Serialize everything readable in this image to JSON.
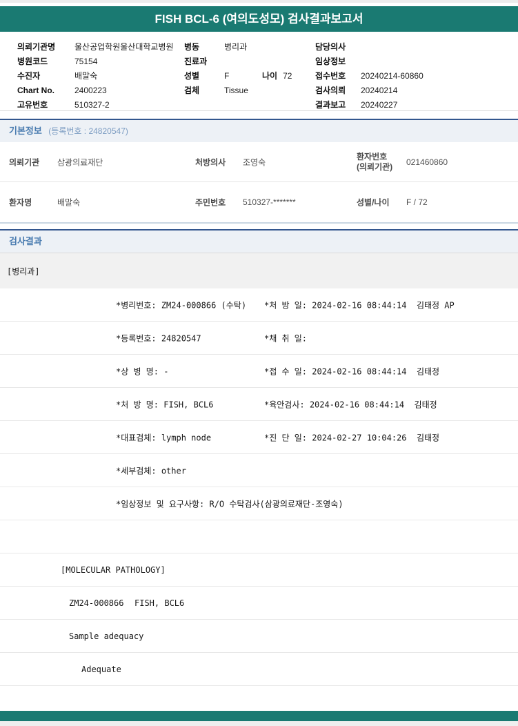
{
  "title": "FISH BCL-6 (여의도성모) 검사결과보고서",
  "header": {
    "left": [
      {
        "label": "의뢰기관명",
        "value": "울산공업학원울산대학교병원"
      },
      {
        "label": "병원코드",
        "value": "75154"
      },
      {
        "label": "수진자",
        "value": "배말숙"
      },
      {
        "label": "Chart No.",
        "value": "2400223"
      },
      {
        "label": "고유번호",
        "value": "510327-2"
      }
    ],
    "middle": [
      {
        "label": "병동",
        "value": "병리과"
      },
      {
        "label": "진료과",
        "value": ""
      },
      {
        "label": "성별",
        "value": "F",
        "label2": "나이",
        "value2": "72"
      },
      {
        "label": "검체",
        "value": "Tissue"
      }
    ],
    "right": [
      {
        "label": "담당의사",
        "value": ""
      },
      {
        "label": "임상정보",
        "value": ""
      },
      {
        "label": "접수번호",
        "value": "20240214-60860"
      },
      {
        "label": "검사의뢰",
        "value": "20240214"
      },
      {
        "label": "결과보고",
        "value": "20240227"
      }
    ]
  },
  "basic_info": {
    "section_title": "기본정보",
    "section_suffix": "(등록번호 : 24820547)",
    "row1": {
      "label1": "의뢰기관",
      "value1": "삼광의료재단",
      "label2": "처방의사",
      "value2": "조영숙",
      "label3_line1": "환자번호",
      "label3_line2": "(의뢰기관)",
      "value3": "021460860"
    },
    "row2": {
      "label1": "환자명",
      "value1": "배말숙",
      "label2": "주민번호",
      "value2": "510327-*******",
      "label3": "성별/나이",
      "value3": "F / 72"
    }
  },
  "results": {
    "section_title": "검사결과",
    "department": "[병리과]",
    "fields": [
      {
        "l": "*병리번호: ZM24-000866 (수탁)",
        "r": "*처 방 일: 2024-02-16 08:44:14  김태정 AP"
      },
      {
        "l": "*등록번호: 24820547",
        "r": "*채 취 일:"
      },
      {
        "l": "*상 병 명: -",
        "r": "*접 수 일: 2024-02-16 08:44:14  김태정"
      },
      {
        "l": "*처 방 명: FISH, BCL6",
        "r": "*육안검사: 2024-02-16 08:44:14  김태정"
      },
      {
        "l": "*대표검체: lymph node",
        "r": "*진 단 일: 2024-02-27 10:04:26  김태정"
      },
      {
        "l": "*세부검체: other",
        "r": ""
      },
      {
        "l": "*임상정보 및 요구사항: R/O 수탁검사(삼광의료재단-조영숙)",
        "r": ""
      }
    ],
    "molecular": {
      "header": "[MOLECULAR PATHOLOGY]",
      "test_no": "ZM24-000866",
      "test_name": "FISH, BCL6",
      "adequacy_label": "Sample adequacy",
      "adequacy_value": "Adequate"
    }
  },
  "colors": {
    "header_teal": "#1A7A72",
    "section_border_navy": "#33568E",
    "section_title_blue": "#4A7CB0",
    "section_bg": "#EDF1F6",
    "dept_band_bg": "#F1F1F1",
    "footer_strip_gray": "#EFEFEF"
  }
}
